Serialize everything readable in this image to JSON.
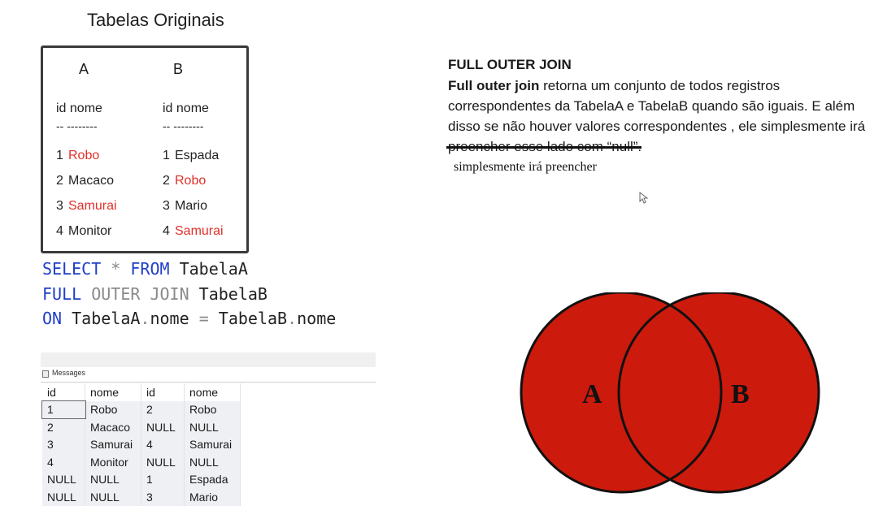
{
  "left": {
    "title": "Tabelas Originais",
    "tableA": {
      "header": "A",
      "col": "id nome",
      "sep": "-- --------",
      "rows": [
        {
          "id": "1",
          "nome": "Robo",
          "highlight": true
        },
        {
          "id": "2",
          "nome": "Macaco",
          "highlight": false
        },
        {
          "id": "3",
          "nome": "Samurai",
          "highlight": true
        },
        {
          "id": "4",
          "nome": "Monitor",
          "highlight": false
        }
      ]
    },
    "tableB": {
      "header": "B",
      "col": "id nome",
      "sep": "-- --------",
      "rows": [
        {
          "id": "1",
          "nome": "Espada",
          "highlight": false
        },
        {
          "id": "2",
          "nome": "Robo",
          "highlight": true
        },
        {
          "id": "3",
          "nome": "Mario",
          "highlight": false
        },
        {
          "id": "4",
          "nome": "Samurai",
          "highlight": true
        }
      ]
    },
    "highlight_color": "#e0302a"
  },
  "sql": {
    "l1_kw1": "SELECT",
    "l1_star": " * ",
    "l1_kw2": "FROM",
    "l1_rest": " TabelaA",
    "l2_kw1": "FULL",
    "l2_gray": " OUTER JOIN",
    "l2_rest": " TabelaB",
    "l3_kw": "ON",
    "l3_a": " TabelaA",
    "l3_dot1": ".",
    "l3_b": "nome ",
    "l3_eq": "=",
    "l3_c": " TabelaB",
    "l3_dot2": ".",
    "l3_d": "nome",
    "keyword_color": "#1f3fc8"
  },
  "results": {
    "tab_label": "Messages",
    "columns": [
      "id",
      "nome",
      "id",
      "nome"
    ],
    "rows": [
      [
        "1",
        "Robo",
        "2",
        "Robo"
      ],
      [
        "2",
        "Macaco",
        "NULL",
        "NULL"
      ],
      [
        "3",
        "Samurai",
        "4",
        "Samurai"
      ],
      [
        "4",
        "Monitor",
        "NULL",
        "NULL"
      ],
      [
        "NULL",
        "NULL",
        "1",
        "Espada"
      ],
      [
        "NULL",
        "NULL",
        "3",
        "Mario"
      ]
    ]
  },
  "right": {
    "title": "FULL OUTER JOIN",
    "desc_bold": "Full outer join",
    "desc_1": " retorna um conjunto de todos registros correspondentes da TabelaA e TabelaB quando são iguais. E além disso se não houver valores correspondentes , ele ",
    "desc_struck": "simplesmente irá preencher",
    "desc_2": " esse lado com “null”.",
    "correction": "simplesmente irá preencher"
  },
  "venn": {
    "label_a": "A",
    "label_b": "B",
    "fill": "#cc1a0c",
    "stroke": "#111111"
  }
}
